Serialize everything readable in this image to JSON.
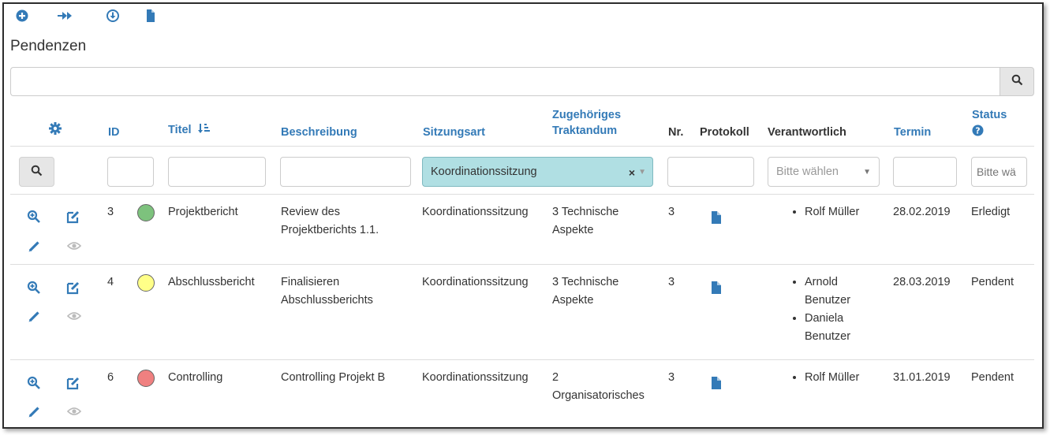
{
  "toolbar": {
    "icons": [
      "plus-circle-icon",
      "forward-icon",
      "download-icon",
      "file-icon"
    ]
  },
  "page": {
    "title": "Pendenzen"
  },
  "search": {
    "placeholder": "",
    "value": ""
  },
  "table": {
    "headers": {
      "id": "ID",
      "titel": "Titel",
      "beschreibung": "Beschreibung",
      "sitzungsart": "Sitzungsart",
      "traktandum_line1": "Zugehöriges",
      "traktandum_line2": "Traktandum",
      "nr": "Nr.",
      "protokoll": "Protokoll",
      "verantwortlich": "Verantwortlich",
      "termin": "Termin",
      "status": "Status"
    },
    "filters": {
      "sitzungsart_selected": "Koordinationssitzung",
      "verantwortlich_placeholder": "Bitte wählen",
      "status_placeholder": "Bitte wä"
    },
    "rows": [
      {
        "id": "3",
        "ampel": "#7dc27d",
        "titel": "Projektbericht",
        "beschreibung": "Review des Projektberichts 1.1.",
        "sitzungsart": "Koordinationssitzung",
        "traktandum": "3 Technische Aspekte",
        "nr": "3",
        "verantwortlich": [
          "Rolf Müller"
        ],
        "termin": "28.02.2019",
        "status": "Erledigt"
      },
      {
        "id": "4",
        "ampel": "#ffff88",
        "titel": "Abschlussbericht",
        "beschreibung": "Finalisieren Abschlussberichts",
        "sitzungsart": "Koordinationssitzung",
        "traktandum": "3 Technische Aspekte",
        "nr": "3",
        "verantwortlich": [
          "Arnold Benutzer",
          "Daniela Benutzer"
        ],
        "termin": "28.03.2019",
        "status": "Pendent"
      },
      {
        "id": "6",
        "ampel": "#f08080",
        "titel": "Controlling",
        "beschreibung": "Controlling Projekt B",
        "sitzungsart": "Koordinationssitzung",
        "traktandum": "2 Organisatorisches",
        "nr": "3",
        "verantwortlich": [
          "Rolf Müller"
        ],
        "termin": "31.01.2019",
        "status": "Pendent"
      }
    ]
  },
  "colors": {
    "link": "#337ab7",
    "select_bg": "#b0dfe3",
    "muted_icon": "#bbbbbb"
  }
}
